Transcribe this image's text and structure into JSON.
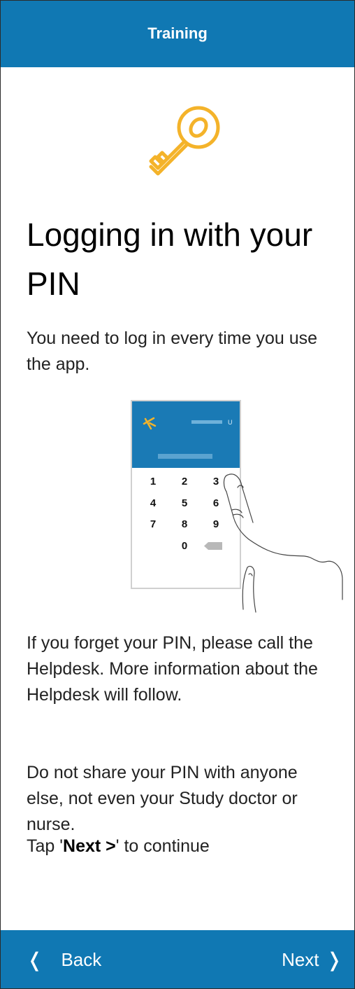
{
  "header": {
    "title": "Training"
  },
  "content": {
    "title": "Logging in with your PIN",
    "para1": "You need to log in every time you use the app.",
    "para2": "If you forget your PIN, please call the Helpdesk. More information about the Helpdesk will follow.",
    "para3": "Do not share your PIN with anyone else, not even your Study doctor or nurse.",
    "tap_prefix": "Tap '",
    "tap_bold": "Next >",
    "tap_suffix": "' to continue"
  },
  "illustration": {
    "keypad_digits": [
      "1",
      "2",
      "3",
      "4",
      "5",
      "6",
      "7",
      "8",
      "9",
      "0"
    ]
  },
  "footer": {
    "back_label": "Back",
    "next_label": "Next"
  },
  "colors": {
    "brand_blue": "#1078b3",
    "key_gold": "#f4b32a"
  },
  "icons": [
    "key-icon",
    "chevron-left-icon",
    "chevron-right-icon",
    "backspace-icon",
    "runner-logo-icon"
  ]
}
